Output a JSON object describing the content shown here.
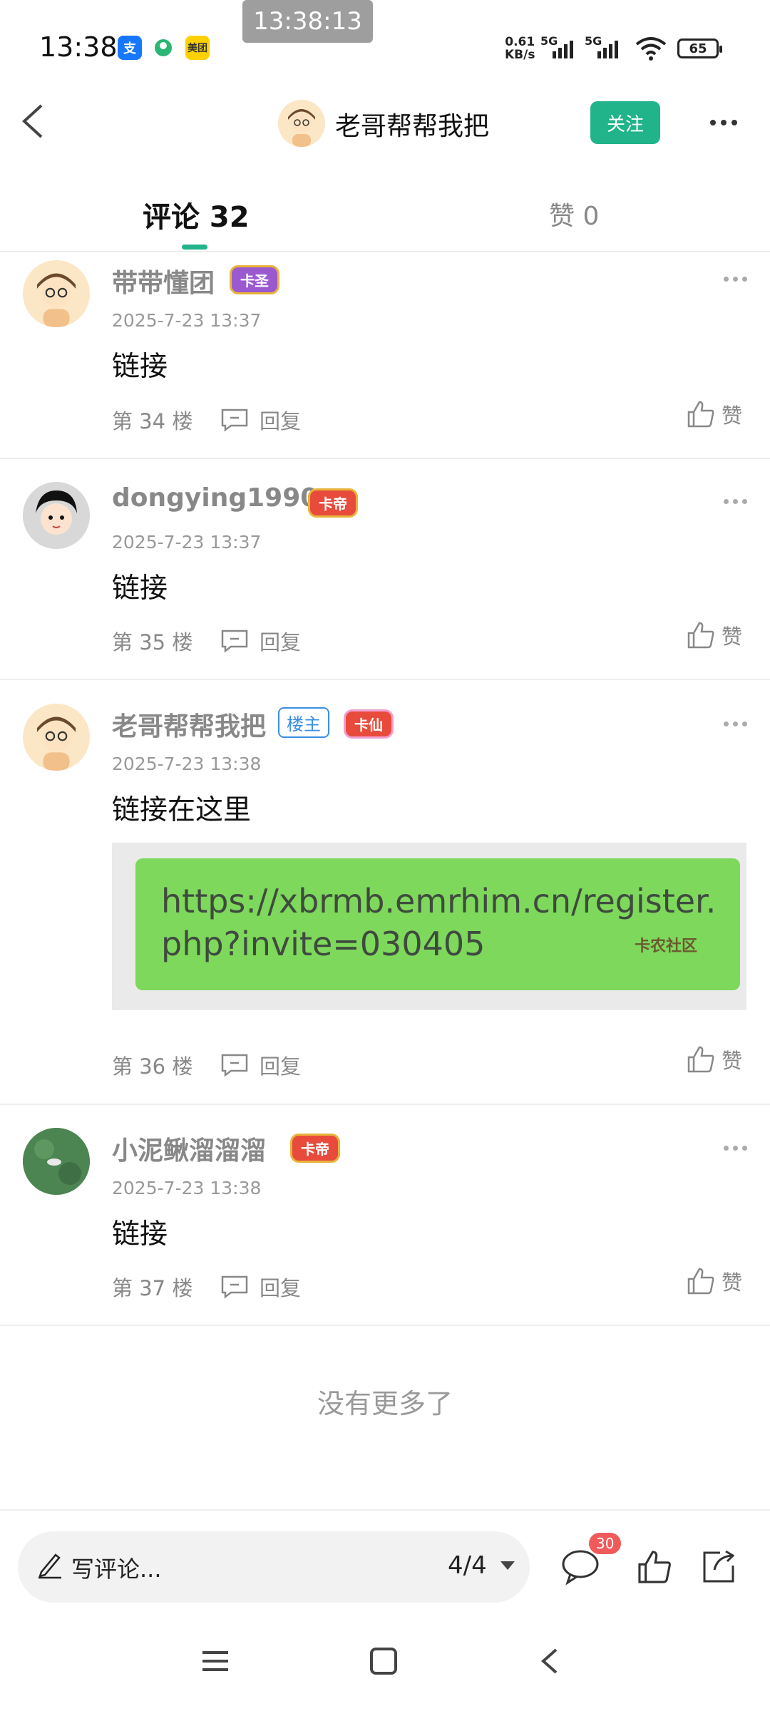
{
  "status_bar": {
    "time": "13:38",
    "overlay_clock": "13:38:13",
    "app_icons": [
      {
        "name": "alipay-icon",
        "label": "支",
        "color": "#1677ff"
      },
      {
        "name": "app-icon",
        "label": "",
        "color": "#2bb673"
      },
      {
        "name": "meituan-icon",
        "label": "美团",
        "color": "#ffd000"
      }
    ],
    "net_speed_value": "0.61",
    "net_speed_unit": "KB/s",
    "sim1": "5G",
    "sim2": "5G",
    "battery": "65"
  },
  "header": {
    "title": "老哥帮帮我把",
    "follow_label": "关注"
  },
  "tabs": {
    "comments_label": "评论 32",
    "likes_label": "赞 0",
    "accent": "#21b38a"
  },
  "comments": [
    {
      "name": "带带懂团",
      "badge": "卡圣",
      "badge_color": "#9b59d0",
      "time": "2025-7-23 13:37",
      "text": "链接",
      "floor": "第 34 楼",
      "reply": "回复",
      "like": "赞"
    },
    {
      "name": "dongying1990",
      "badge": "卡帝",
      "badge_color": "#e84b3c",
      "time": "2025-7-23 13:37",
      "text": "链接",
      "floor": "第 35 楼",
      "reply": "回复",
      "like": "赞"
    },
    {
      "name": "老哥帮帮我把",
      "owner_tag": "楼主",
      "badge": "卡仙",
      "badge_color": "#e84b3c",
      "time": "2025-7-23 13:38",
      "text": "链接在这里",
      "image_text_line1": "https://xbrmb.emrhim.cn/register.",
      "image_text_line2": "php?invite=030405",
      "watermark": "卡农社区",
      "floor": "第 36 楼",
      "reply": "回复",
      "like": "赞"
    },
    {
      "name": "小泥鳅溜溜溜",
      "badge": "卡帝",
      "badge_color": "#e84b3c",
      "time": "2025-7-23 13:38",
      "text": "链接",
      "floor": "第 37 楼",
      "reply": "回复",
      "like": "赞"
    }
  ],
  "end_text": "没有更多了",
  "bottom_bar": {
    "input_placeholder": "写评论...",
    "pager": "4/4",
    "comment_count_badge": "30"
  }
}
